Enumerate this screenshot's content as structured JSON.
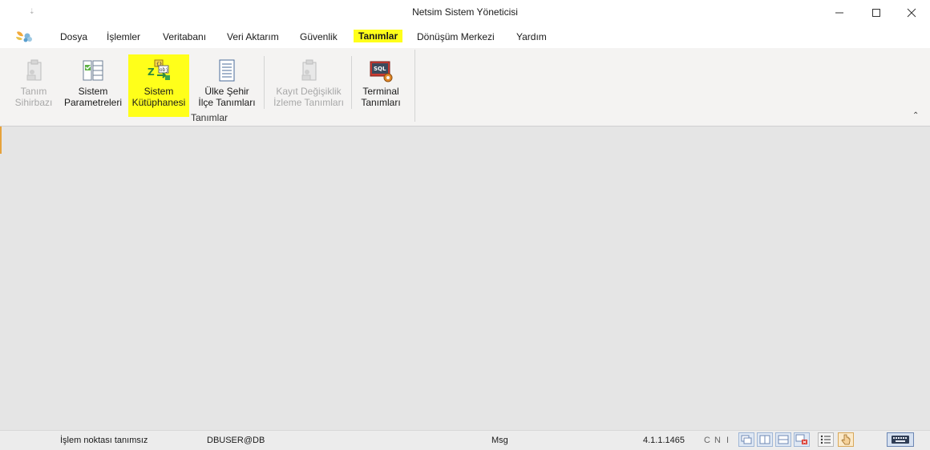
{
  "window": {
    "title": "Netsim Sistem Yöneticisi",
    "quick_access": "⇣",
    "controls": {
      "minimize_icon": "minimize-icon",
      "maximize_icon": "maximize-icon",
      "close_icon": "close-icon"
    }
  },
  "menu": {
    "logo_icon": "butterfly-app-icon",
    "items": [
      {
        "label": "Dosya"
      },
      {
        "label": "İşlemler"
      },
      {
        "label": "Veritabanı"
      },
      {
        "label": "Veri Aktarım"
      },
      {
        "label": "Güvenlik"
      },
      {
        "label": "Tanımlar",
        "active": true
      },
      {
        "label": "Dönüşüm Merkezi"
      },
      {
        "label": "Yardım"
      }
    ]
  },
  "ribbon": {
    "group_label": "Tanımlar",
    "collapse_glyph": "⌃",
    "buttons": [
      {
        "line1": "Tanım",
        "line2": "Sihirbazı",
        "icon": "wizard-clipboard-icon",
        "disabled": true
      },
      {
        "line1": "Sistem",
        "line2": "Parametreleri",
        "icon": "parameters-checklist-icon",
        "disabled": false
      },
      {
        "line1": "Sistem",
        "line2": "Kütüphanesi",
        "icon": "library-code-icon",
        "disabled": false,
        "highlighted": true
      },
      {
        "line1": "Ülke Şehir",
        "line2": "İlçe Tanımları",
        "icon": "document-list-icon",
        "disabled": false
      },
      {
        "line1": "Kayıt Değişiklik",
        "line2": "İzleme Tanımları",
        "icon": "change-tracking-icon",
        "disabled": true
      },
      {
        "line1": "Terminal",
        "line2": "Tanımları",
        "icon": "sql-terminal-icon",
        "disabled": false
      }
    ]
  },
  "status": {
    "operation_point": "İşlem noktası tanımsız",
    "db_user": "DBUSER@DB",
    "message": "Msg",
    "version": "4.1.1.1465",
    "flags": [
      "C",
      "N",
      "I"
    ],
    "buttons": [
      "cascade-windows-icon",
      "tile-vertical-icon",
      "tile-horizontal-icon",
      "close-all-windows-icon",
      "list-view-icon",
      "hand-pointer-icon",
      "keyboard-icon"
    ]
  },
  "colors": {
    "highlight": "#ffff1a",
    "ribbon_bg": "#f4f3f2",
    "workspace_bg": "#e5e5e5"
  }
}
